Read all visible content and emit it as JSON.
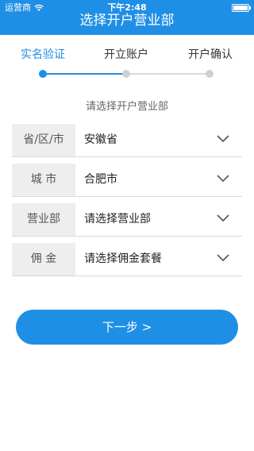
{
  "status_bar": {
    "carrier": "运营商",
    "time": "下午2:48",
    "wifi_icon": "wifi-icon",
    "battery_icon": "battery-icon"
  },
  "header": {
    "title": "选择开户营业部",
    "background_color": "#1f8fe6"
  },
  "steps": [
    {
      "label": "实名验证",
      "active": true
    },
    {
      "label": "开立账户",
      "active": false
    },
    {
      "label": "开户确认",
      "active": false
    }
  ],
  "hint": "请选择开户营业部",
  "form": {
    "rows": [
      {
        "label": "省/区/市",
        "value": "安徽省",
        "icon": "chevron-down-icon"
      },
      {
        "label": "城 市",
        "value": "合肥市",
        "icon": "chevron-down-icon"
      },
      {
        "label": "营业部",
        "value": "请选择营业部",
        "icon": "chevron-down-icon"
      },
      {
        "label": "佣 金",
        "value": "请选择佣金套餐",
        "icon": "chevron-down-icon"
      }
    ]
  },
  "next_button": {
    "label": "下一步 >"
  },
  "colors": {
    "accent": "#1f8fe6",
    "inactive": "#cfcfcf",
    "label_bg": "#eeeeee"
  }
}
